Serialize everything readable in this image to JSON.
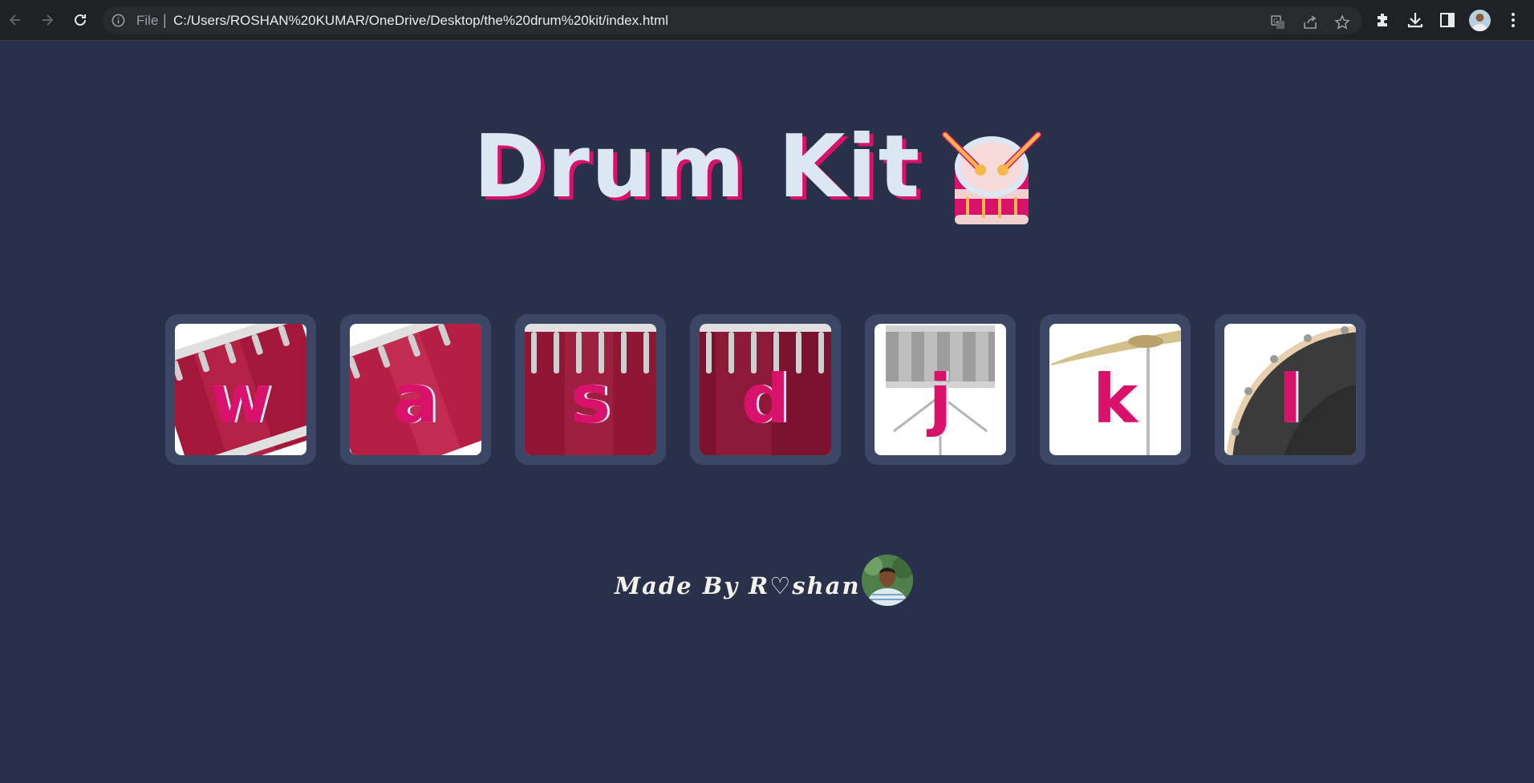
{
  "browser": {
    "scheme_label": "File",
    "separator": "|",
    "url": "C:/Users/ROSHAN%20KUMAR/OneDrive/Desktop/the%20drum%20kit/index.html",
    "icons": [
      "back-arrow-icon",
      "forward-arrow-icon",
      "reload-icon",
      "info-icon",
      "translate-icon",
      "share-icon",
      "star-icon",
      "extensions-icon",
      "download-icon",
      "side-panel-icon",
      "profile-avatar",
      "kebab-menu-icon"
    ]
  },
  "page": {
    "title": "Drum Kit",
    "title_emoji": "drum-icon",
    "pads": [
      {
        "key": "w",
        "instrument": "tom-1"
      },
      {
        "key": "a",
        "instrument": "tom-2"
      },
      {
        "key": "s",
        "instrument": "tom-3"
      },
      {
        "key": "d",
        "instrument": "tom-4"
      },
      {
        "key": "j",
        "instrument": "snare"
      },
      {
        "key": "k",
        "instrument": "crash"
      },
      {
        "key": "l",
        "instrument": "kick-bass"
      }
    ],
    "footer": {
      "text": "Made By R♡shan",
      "heart_icon": "orange-heart-icon"
    }
  },
  "colors": {
    "background": "#283149",
    "pad_frame": "#3c4766",
    "accent_pink": "#d8126b",
    "title_text": "#dbe8f3"
  }
}
